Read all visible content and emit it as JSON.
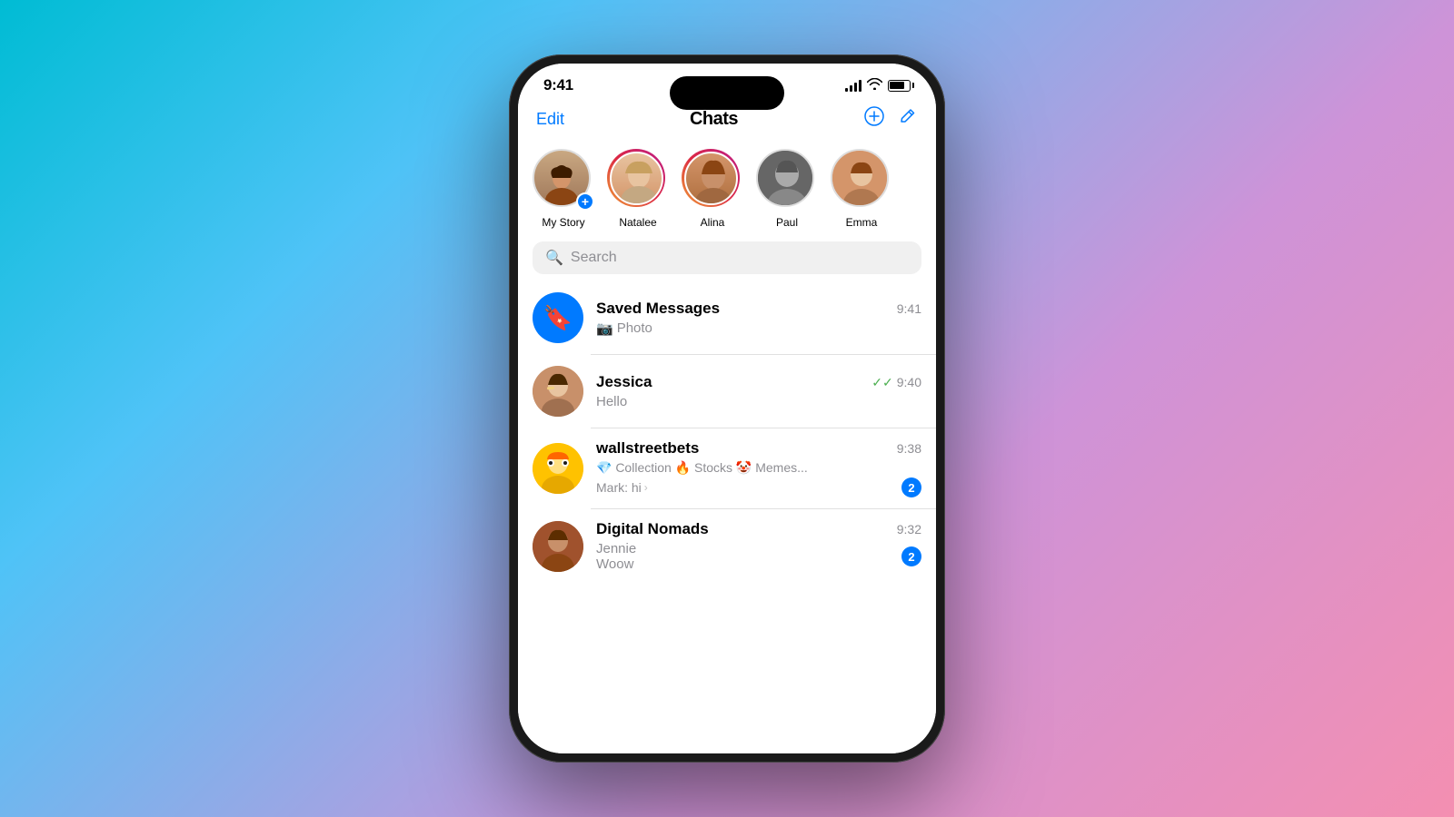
{
  "background": {
    "gradient": "linear-gradient(135deg, #00bcd4, #4fc3f7, #ce93d8, #f48fb1)"
  },
  "statusBar": {
    "time": "9:41",
    "signal": 4,
    "wifi": true,
    "battery": 80
  },
  "header": {
    "editLabel": "Edit",
    "title": "Chats",
    "addIcon": "⊕",
    "composeIcon": "✏"
  },
  "stories": [
    {
      "name": "My Story",
      "isOwn": true,
      "hasRing": false
    },
    {
      "name": "Natalee",
      "isOwn": false,
      "hasRing": true
    },
    {
      "name": "Alina",
      "isOwn": false,
      "hasRing": true
    },
    {
      "name": "Paul",
      "isOwn": false,
      "hasRing": false
    },
    {
      "name": "Emma",
      "isOwn": false,
      "hasRing": false
    }
  ],
  "search": {
    "placeholder": "Search"
  },
  "chats": [
    {
      "id": "saved",
      "name": "Saved Messages",
      "preview": "📷 Photo",
      "time": "9:41",
      "unread": 0,
      "type": "saved"
    },
    {
      "id": "jessica",
      "name": "Jessica",
      "preview": "Hello",
      "time": "9:40",
      "unread": 0,
      "delivered": true,
      "type": "person"
    },
    {
      "id": "wallstreetbets",
      "name": "wallstreetbets",
      "desc": "💎 Collection 🔥 Stocks 🤡 Memes...",
      "preview": "Mark: hi",
      "time": "9:38",
      "unread": 2,
      "type": "group"
    },
    {
      "id": "digitalnomads",
      "name": "Digital Nomads",
      "preview": "Jennie",
      "subPreview": "Woow",
      "time": "9:32",
      "unread": 2,
      "type": "group"
    }
  ]
}
